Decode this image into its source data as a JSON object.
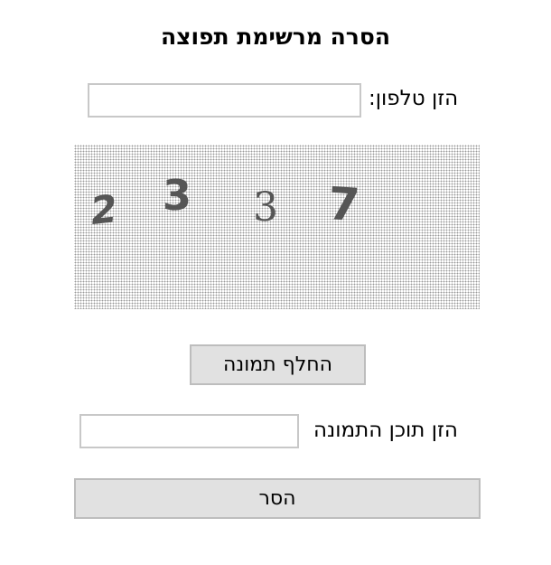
{
  "title": "הסרה מרשימת תפוצה",
  "phone": {
    "label": "הזן טלפון:",
    "value": ""
  },
  "captcha": {
    "digits": [
      "2",
      "3",
      "3",
      "7"
    ],
    "digit_color": "#555555"
  },
  "refresh_button": "החלף תמונה",
  "captcha_input": {
    "label": "הזן תוכן התמונה",
    "value": ""
  },
  "remove_button": "הסר"
}
